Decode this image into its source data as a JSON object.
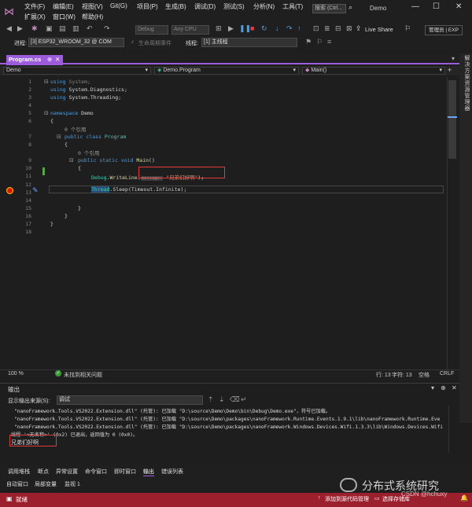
{
  "menu": {
    "items": [
      "文件(F)",
      "编辑(E)",
      "视图(V)",
      "Git(G)",
      "项目(P)",
      "生成(B)",
      "调试(D)",
      "测试(S)",
      "分析(N)",
      "工具(T)"
    ],
    "row2": [
      "扩展(X)",
      "窗口(W)",
      "帮助(H)"
    ],
    "search_placeholder": "搜索 (Ctrl...",
    "app_title": "Demo",
    "win_min": "—",
    "win_max": "☐",
    "win_close": "✕"
  },
  "toolbar": {
    "config": "Debug",
    "platform": "Any CPU",
    "live_share": "Live Share",
    "admin": "管理员 | EXP"
  },
  "debugbar": {
    "process_label": "进程:",
    "process_value": "[3] ESP32_WROOM_32 @ COM",
    "lifecycle": "生命周期事件",
    "thread_label": "线程:",
    "thread_value": "[1] 主线程"
  },
  "tab": {
    "title": "Program.cs",
    "close": "✕"
  },
  "nav": {
    "project": "Demo",
    "class": "Demo.Program",
    "method": "Main()"
  },
  "right_strip": "解决方案资源管理器",
  "code": {
    "line_numbers": [
      "1",
      "2",
      "3",
      "4",
      "5",
      "6",
      "7",
      "8",
      "9",
      "10",
      "11",
      "12",
      "13",
      "14",
      "15",
      "16",
      "17",
      "18"
    ],
    "using1_kw": "using",
    "using1_ns": "System;",
    "using2_kw": "using",
    "using2_ns": "System.Diagnostics;",
    "using3_kw": "using",
    "using3_ns": "System.Threading;",
    "ns_kw": "namespace",
    "ns_name": "Demo",
    "brace_open": "{",
    "brace_close": "}",
    "refs1": "0 个引用",
    "class_kw": "public class",
    "class_name": "Program",
    "refs2": "0 个引用",
    "main_kw": "public static void",
    "main_name": "Main",
    "main_paren": "()",
    "debug_type": "Debug",
    "writeline": ".WriteLine(",
    "param_hint": "message:",
    "string_value": "\"兄弟们好啊\"",
    "writeline_end": ");",
    "thread_type": "Thread",
    "sleep": ".Sleep(Timeout.Infinite);"
  },
  "editor_status": {
    "zoom": "100 %",
    "issues": "未找到相关问题",
    "line": "行: 13",
    "char": "字符: 13",
    "spaces": "空格",
    "eol": "CRLF"
  },
  "output": {
    "title": "输出",
    "show_from_label": "显示输出来源(S):",
    "source": "调试",
    "lines": [
      "\"nanoFramework.Tools.VS2022.Extension.dll\" (托管): 已加载 \"D:\\source\\Demo\\Demo\\bin\\Debug\\Demo.exe\"，符号已加载。",
      "\"nanoFramework.Tools.VS2022.Extension.dll\" (托管): 已加载 \"D:\\source\\Demo\\packages\\nanoFramework.Runtime.Events.1.9.1\\lib\\nanoFramework.Runtime.Eve",
      "\"nanoFramework.Tools.VS2022.Extension.dll\" (托管): 已加载 \"D:\\source\\Demo\\packages\\nanoFramework.Windows.Devices.Wifi.1.3.3\\lib\\Windows.Devices.Wifi",
      "线程 '<无名称>' (0x2) 已退出，返回值为 0 (0x0)。",
      "兄弟们好啊"
    ]
  },
  "bottom_tabs": [
    "调用堆栈",
    "断点",
    "异常设置",
    "命令窗口",
    "即时窗口",
    "输出",
    "错误列表"
  ],
  "bottom_tabs2": [
    "自动窗口",
    "局部变量",
    "监视 1"
  ],
  "status": {
    "ready": "就绪",
    "source_control": "添加到源代码管理",
    "repo": "选择存储库"
  },
  "watermark": {
    "text": "分布式系统研究",
    "author": "CSDN @hchuxy"
  }
}
